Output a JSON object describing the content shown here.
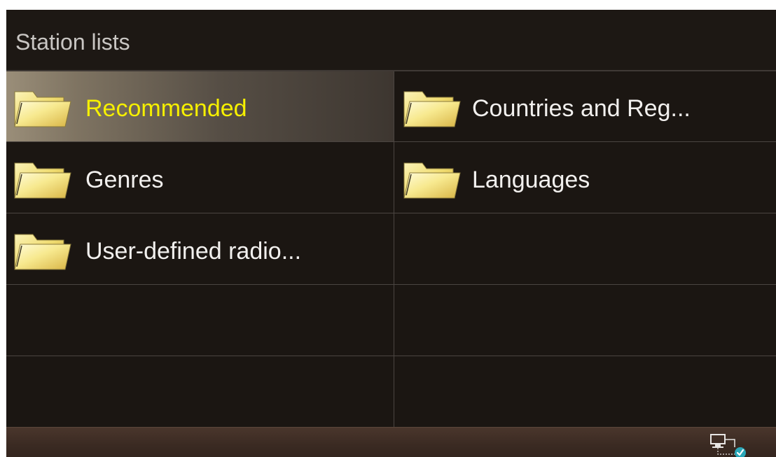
{
  "title": "Station lists",
  "items": [
    {
      "label": "Recommended",
      "icon": "folder-icon",
      "selected": true
    },
    {
      "label": "Countries and Reg...",
      "icon": "folder-icon",
      "selected": false
    },
    {
      "label": "Genres",
      "icon": "folder-icon",
      "selected": false
    },
    {
      "label": "Languages",
      "icon": "folder-icon",
      "selected": false
    },
    {
      "label": "User-defined radio...",
      "icon": "folder-icon",
      "selected": false
    }
  ],
  "status": {
    "network_icon": "network-connected-icon"
  },
  "colors": {
    "background": "#1b1612",
    "selected_text": "#f6f000",
    "text": "#f2f0ee",
    "title_text": "#c9c6c3",
    "folder": "#f0d870",
    "status_bar": "#3a2a22"
  }
}
